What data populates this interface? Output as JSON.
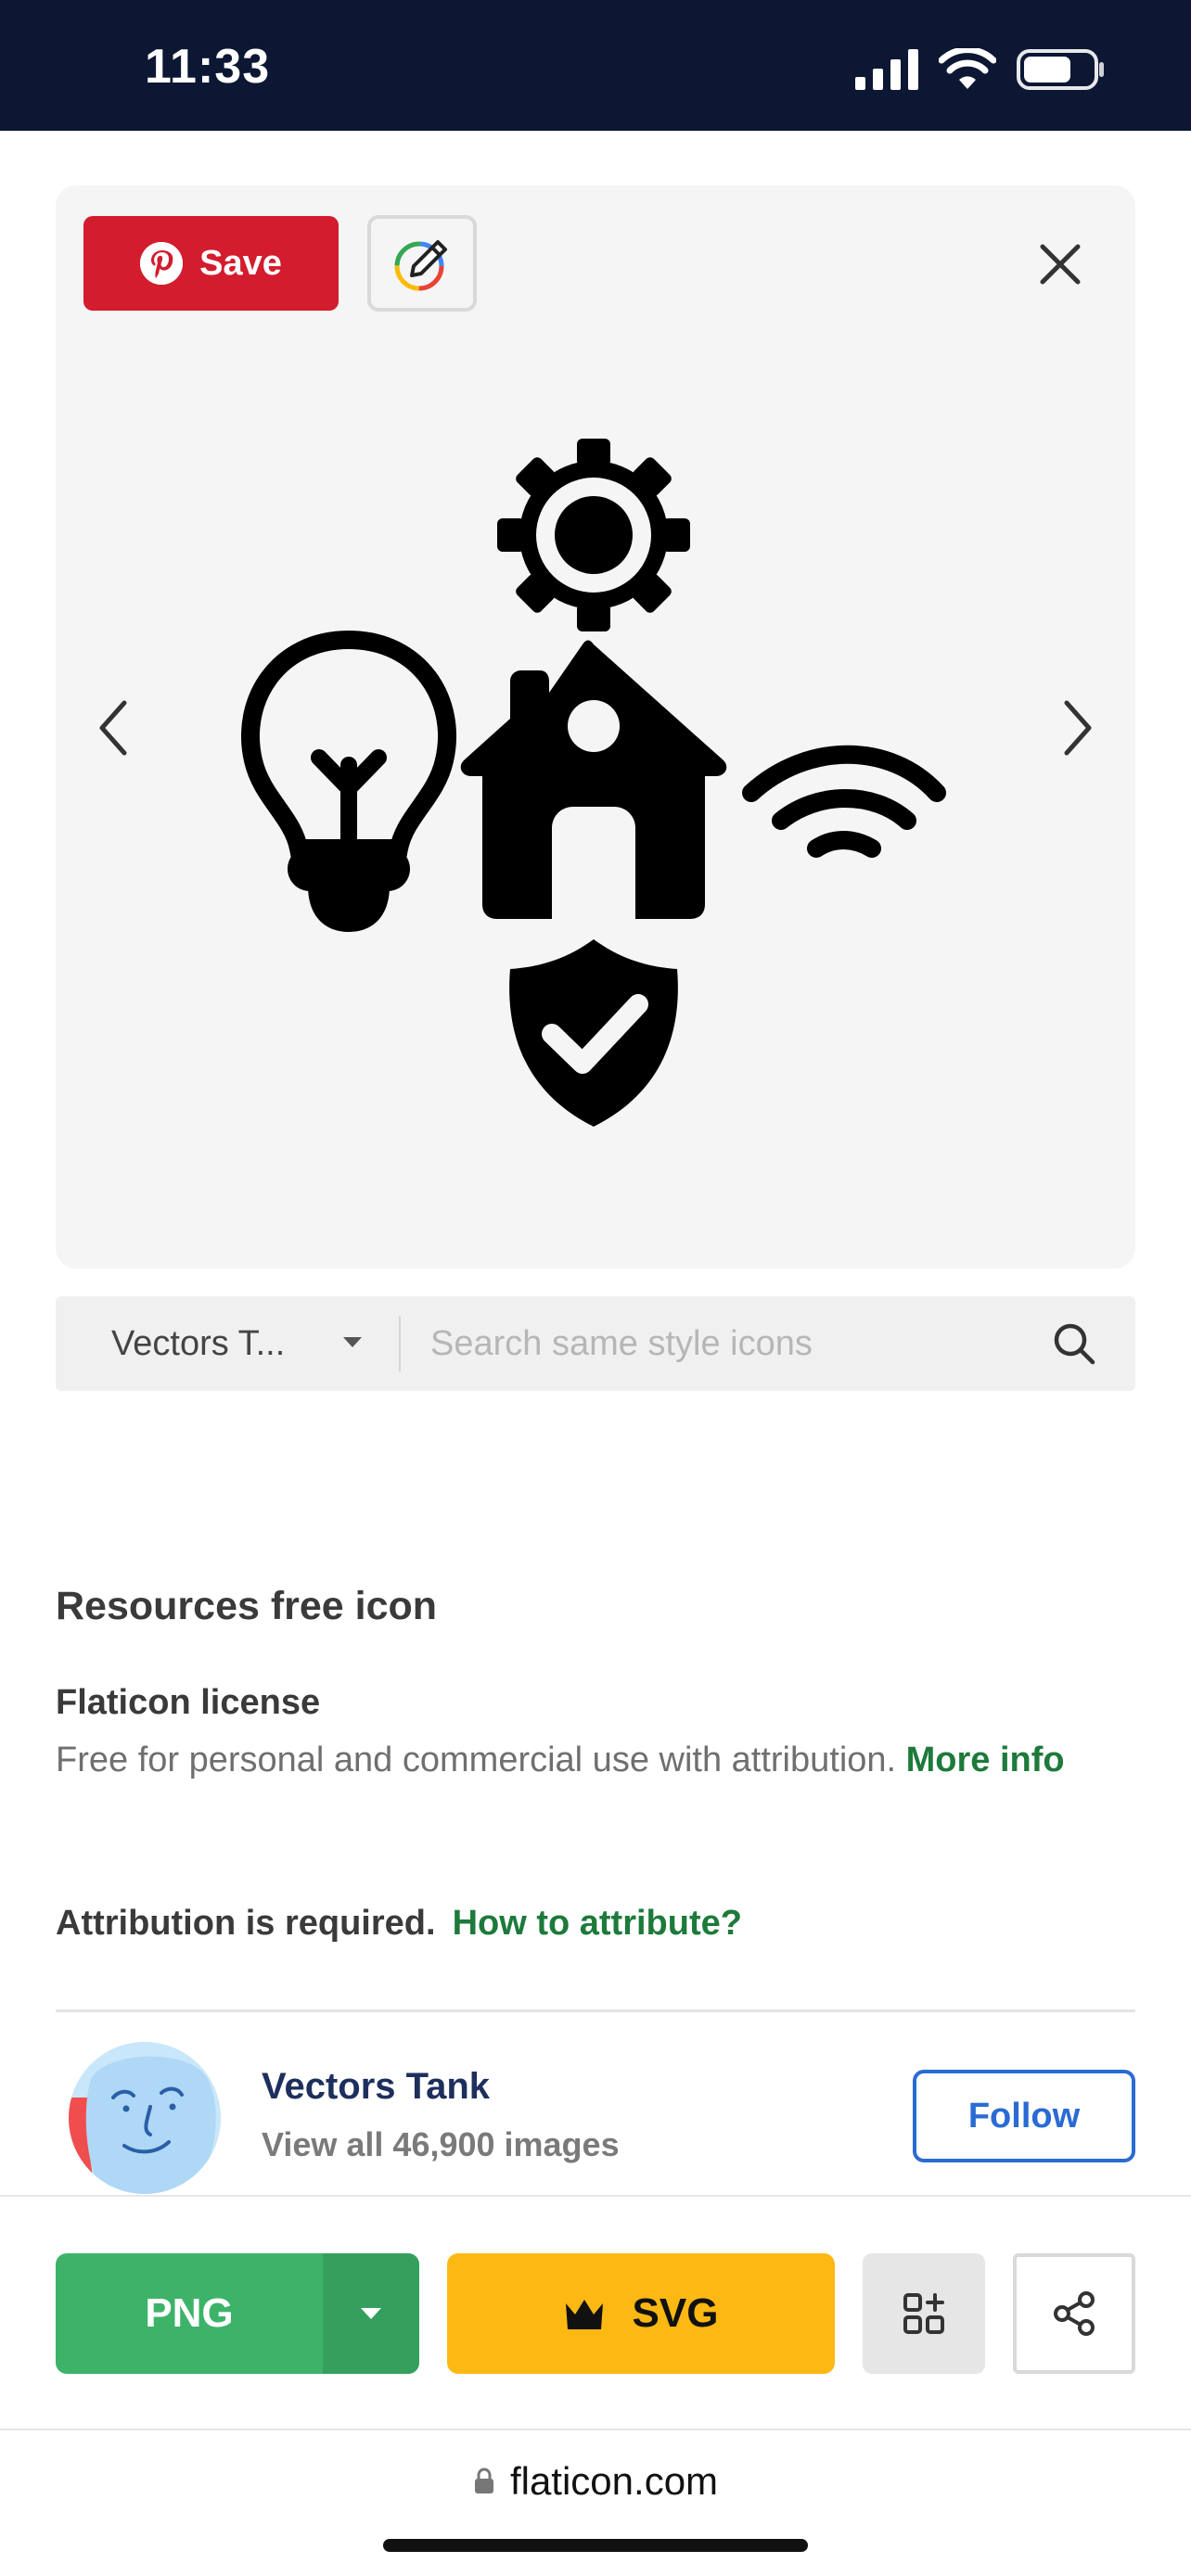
{
  "status_bar": {
    "time": "11:33"
  },
  "preview": {
    "save_label": "Save"
  },
  "style_search": {
    "selected_style": "Vectors T...",
    "placeholder": "Search same style icons"
  },
  "resource": {
    "title": "Resources free icon",
    "license_title": "Flaticon license",
    "license_text": "Free for personal and commercial use with attribution.",
    "more_info_link": "More info",
    "attribution_text": "Attribution is required.",
    "attribution_link": "How to attribute?"
  },
  "author": {
    "name": "Vectors Tank",
    "subtitle": "View all 46,900 images",
    "follow_label": "Follow"
  },
  "actions": {
    "png_label": "PNG",
    "svg_label": "SVG"
  },
  "browser": {
    "url": "flaticon.com"
  },
  "colors": {
    "status_bar_bg": "#0b1733",
    "pinterest_red": "#d31c2d",
    "png_green": "#3db36a",
    "svg_yellow": "#fdb813",
    "follow_blue": "#2a6bd3",
    "link_green": "#1d7a3b"
  },
  "icons": [
    "signal-icon",
    "wifi-icon",
    "battery-icon",
    "pinterest-icon",
    "edit-pencil-icon",
    "close-icon",
    "chevron-left-icon",
    "chevron-right-icon",
    "search-icon",
    "crown-icon",
    "add-to-collection-icon",
    "share-icon",
    "lock-icon"
  ]
}
